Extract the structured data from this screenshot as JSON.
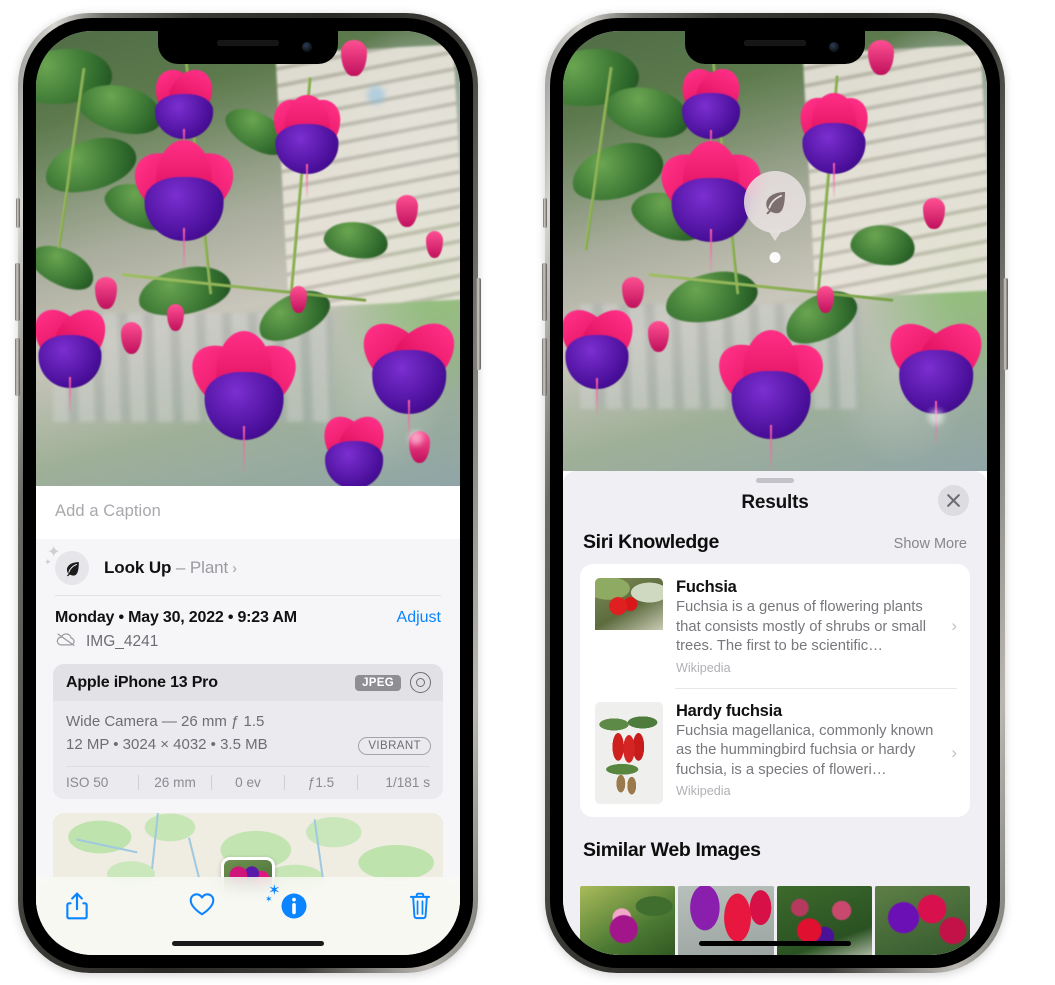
{
  "left_phone": {
    "caption_placeholder": "Add a Caption",
    "lookup": {
      "label": "Look Up",
      "dash": " – ",
      "subject": "Plant",
      "chevron": "›",
      "icon": "leaf-icon",
      "sparkle": "✦",
      "sparkle_small": "✦"
    },
    "date_line": "Monday • May 30, 2022 • 9:23 AM",
    "adjust_label": "Adjust",
    "file_name": "IMG_4241",
    "file_icon": "icloud-slash-icon",
    "exif": {
      "model": "Apple iPhone 13 Pro",
      "format_badge": "JPEG",
      "aperture_icon": "aperture-icon",
      "lens_line": "Wide Camera — 26 mm ƒ 1.5",
      "size_line": "12 MP • 3024 × 4032 • 3.5 MB",
      "style_badge": "VIBRANT",
      "stats": [
        "ISO 50",
        "26 mm",
        "0 ev",
        "ƒ1.5",
        "1/181 s"
      ]
    },
    "toolbar": {
      "share": "share-icon",
      "favorite": "heart-icon",
      "info": "info-sparkle-icon",
      "delete": "trash-icon"
    }
  },
  "right_phone": {
    "pin_icon": "leaf-icon",
    "title": "Results",
    "close_icon": "close-icon",
    "siri_section": {
      "title": "Siri Knowledge",
      "show_more": "Show More",
      "entries": [
        {
          "name": "Fuchsia",
          "description": "Fuchsia is a genus of flowering plants that consists mostly of shrubs or small trees. The first to be scientific…",
          "source": "Wikipedia",
          "chevron": "›"
        },
        {
          "name": "Hardy fuchsia",
          "description": "Fuchsia magellanica, commonly known as the hummingbird fuchsia or hardy fuchsia, is a species of floweri…",
          "source": "Wikipedia",
          "chevron": "›"
        }
      ]
    },
    "web_section": {
      "title": "Similar Web Images",
      "images": [
        "fuchsia-thumb-1",
        "fuchsia-thumb-2",
        "fuchsia-thumb-3",
        "fuchsia-thumb-4"
      ]
    }
  },
  "colors": {
    "accent_blue": "#0a84ff",
    "sheet_bg": "#f6f6f8",
    "results_bg": "#f0eff4",
    "card_bg": "#ffffff",
    "muted_text": "#8a8a90"
  }
}
